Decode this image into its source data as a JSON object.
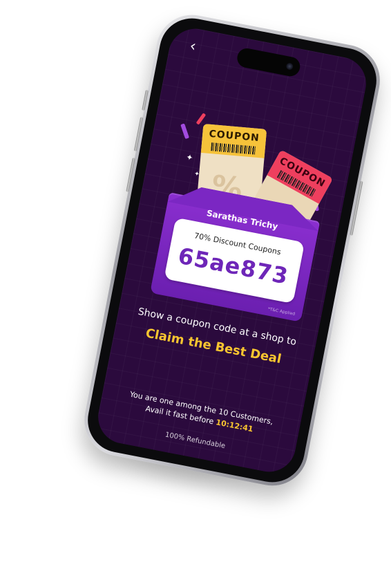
{
  "nav": {
    "back_icon": "chevron-left-icon"
  },
  "coupon": {
    "ticket_1_label": "COUPON",
    "ticket_2_label": "COUPON",
    "percent_symbol": "%",
    "store_name": "Sarathas Trichy",
    "title": "70% Discount Coupons",
    "code": "65ae873",
    "tc_note": "*T&C Applied"
  },
  "promo": {
    "headline": "Show a coupon code at a shop to",
    "claim": "Claim the Best Deal"
  },
  "info": {
    "line1": "You are one among the 10 Customers,",
    "line2_prefix": "Avail it fast before",
    "countdown": "10:12:41",
    "refund": "100% Refundable"
  },
  "colors": {
    "screen_bg": "#2b0a3d",
    "accent_yellow": "#f8c530",
    "code_purple": "#6e26b8",
    "pocket_purple": "#7b27c3",
    "ticket_red": "#ee3f5e"
  }
}
